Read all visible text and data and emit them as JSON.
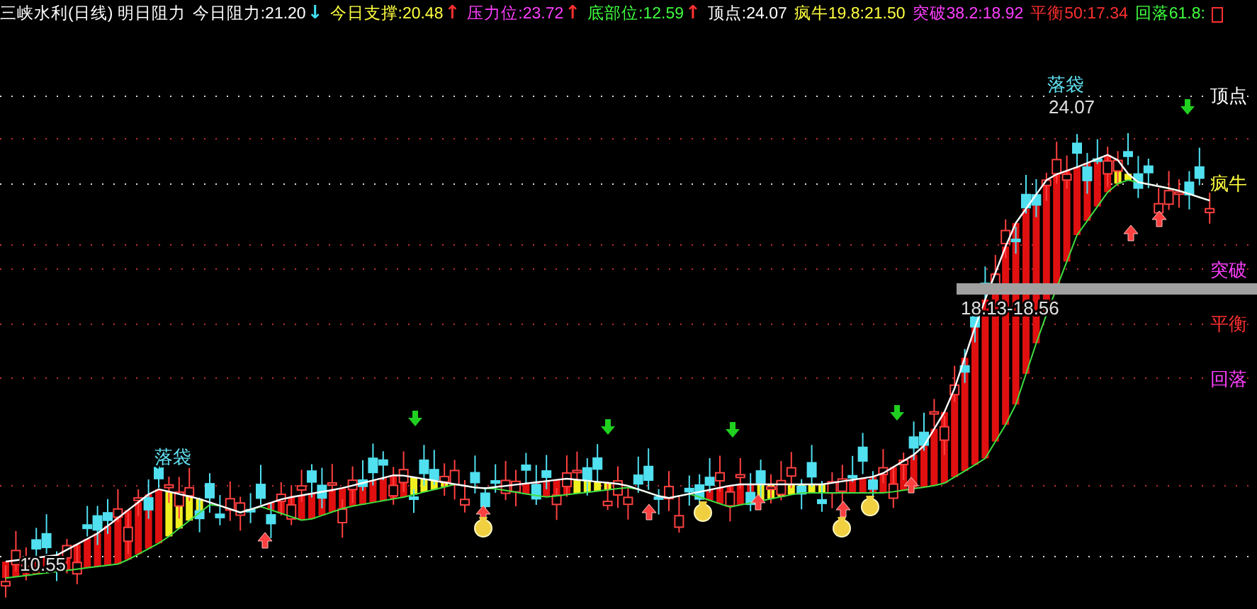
{
  "header": {
    "title": "三峡水利(日线) 明日阻力",
    "items": [
      {
        "label": "今日阻力:21.20",
        "color": "#ffffff",
        "arrow": {
          "symbol": "↓",
          "color": "#40e0f0"
        }
      },
      {
        "label": "今日支撑:20.48",
        "color": "#ffff40",
        "arrow": {
          "symbol": "↑",
          "color": "#ff3030"
        }
      },
      {
        "label": "压力位:23.72",
        "color": "#ff40ff",
        "arrow": {
          "symbol": "↑",
          "color": "#ff3030"
        }
      },
      {
        "label": "底部位:12.59",
        "color": "#40ff40",
        "arrow": {
          "symbol": "↑",
          "color": "#ff3030"
        }
      },
      {
        "label": "顶点:24.07",
        "color": "#ffffff"
      },
      {
        "label": "疯牛19.8:21.50",
        "color": "#ffff40"
      },
      {
        "label": "突破38.2:18.92",
        "color": "#ff40ff"
      },
      {
        "label": "平衡50:17.34",
        "color": "#ff3030"
      },
      {
        "label": "回落61.8:",
        "color": "#40ff40"
      }
    ]
  },
  "chart": {
    "levels": [
      {
        "label": "顶点",
        "color": "#ffffff"
      },
      {
        "label": "疯牛",
        "color": "#ffff40"
      },
      {
        "label": "突破",
        "color": "#ff40ff"
      },
      {
        "label": "平衡",
        "color": "#ff3030"
      },
      {
        "label": "回落",
        "color": "#ff40ff"
      }
    ],
    "band_label": "18.13-18.56",
    "peak_label": "24.07",
    "low_label": "10.55",
    "signals": [
      "落袋",
      "落袋"
    ]
  }
}
